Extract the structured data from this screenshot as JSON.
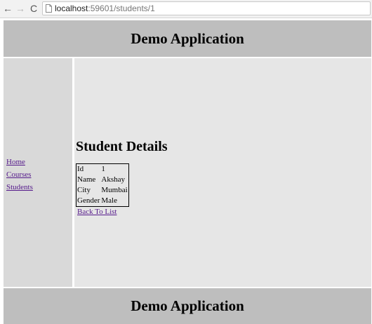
{
  "browser": {
    "url_host": "localhost",
    "url_rest": ":59601/students/1",
    "back_icon": "←",
    "forward_icon": "→",
    "reload_icon": "C"
  },
  "header": {
    "title": "Demo Application"
  },
  "sidebar": {
    "items": [
      {
        "label": "Home"
      },
      {
        "label": "Courses"
      },
      {
        "label": "Students"
      }
    ]
  },
  "main": {
    "heading": "Student Details",
    "details": [
      {
        "label": "Id",
        "value": "1"
      },
      {
        "label": "Name",
        "value": "Akshay"
      },
      {
        "label": "City",
        "value": "Mumbai"
      },
      {
        "label": "Gender",
        "value": "Male"
      }
    ],
    "back_link": "Back To List"
  },
  "footer": {
    "title": "Demo Application"
  },
  "colors": {
    "header_bg": "#bebebe",
    "sidebar_bg": "#d9d9d9",
    "content_bg": "#e6e6e6",
    "link": "#551a8b"
  }
}
